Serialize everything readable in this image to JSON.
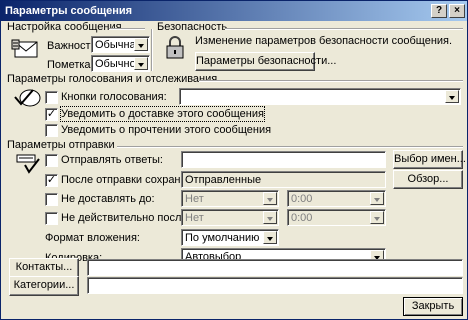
{
  "window": {
    "title": "Параметры сообщения"
  },
  "message_settings": {
    "heading": "Настройка сообщения",
    "importance_label": "Важность:",
    "importance_value": "Обычная",
    "sensitivity_label": "Пометка:",
    "sensitivity_value": "Обычное"
  },
  "security": {
    "heading": "Безопасность",
    "description": "Изменение параметров безопасности сообщения.",
    "button_label": "Параметры безопасности..."
  },
  "voting": {
    "heading": "Параметры голосования и отслеживания",
    "voting_buttons_label": "Кнопки голосования:",
    "voting_buttons_checked": false,
    "voting_buttons_value": "",
    "delivery_receipt_label": "Уведомить о доставке этого сообщения",
    "delivery_receipt_checked": true,
    "read_receipt_label": "Уведомить о прочтении этого сообщения",
    "read_receipt_checked": false
  },
  "delivery": {
    "heading": "Параметры отправки",
    "replies_label": "Отправлять ответы:",
    "replies_checked": false,
    "replies_value": "",
    "select_names_button": "Выбор имен...",
    "save_sent_label": "После отправки сохранить в:",
    "save_sent_checked": true,
    "save_sent_value": "Отправленные",
    "browse_button": "Обзор...",
    "deliver_before_label": "Не доставлять до:",
    "deliver_before_checked": false,
    "deliver_before_date": "Нет",
    "deliver_before_time": "0:00",
    "expires_label": "Не действительно после:",
    "expires_checked": false,
    "expires_date": "Нет",
    "expires_time": "0:00",
    "attachment_format_label": "Формат вложения:",
    "attachment_format_value": "По умолчанию",
    "encoding_label": "Кодировка:",
    "encoding_value": "Автовыбор"
  },
  "contacts": {
    "button_label": "Контакты...",
    "value": ""
  },
  "categories": {
    "button_label": "Категории...",
    "value": ""
  },
  "close_button": "Закрыть"
}
